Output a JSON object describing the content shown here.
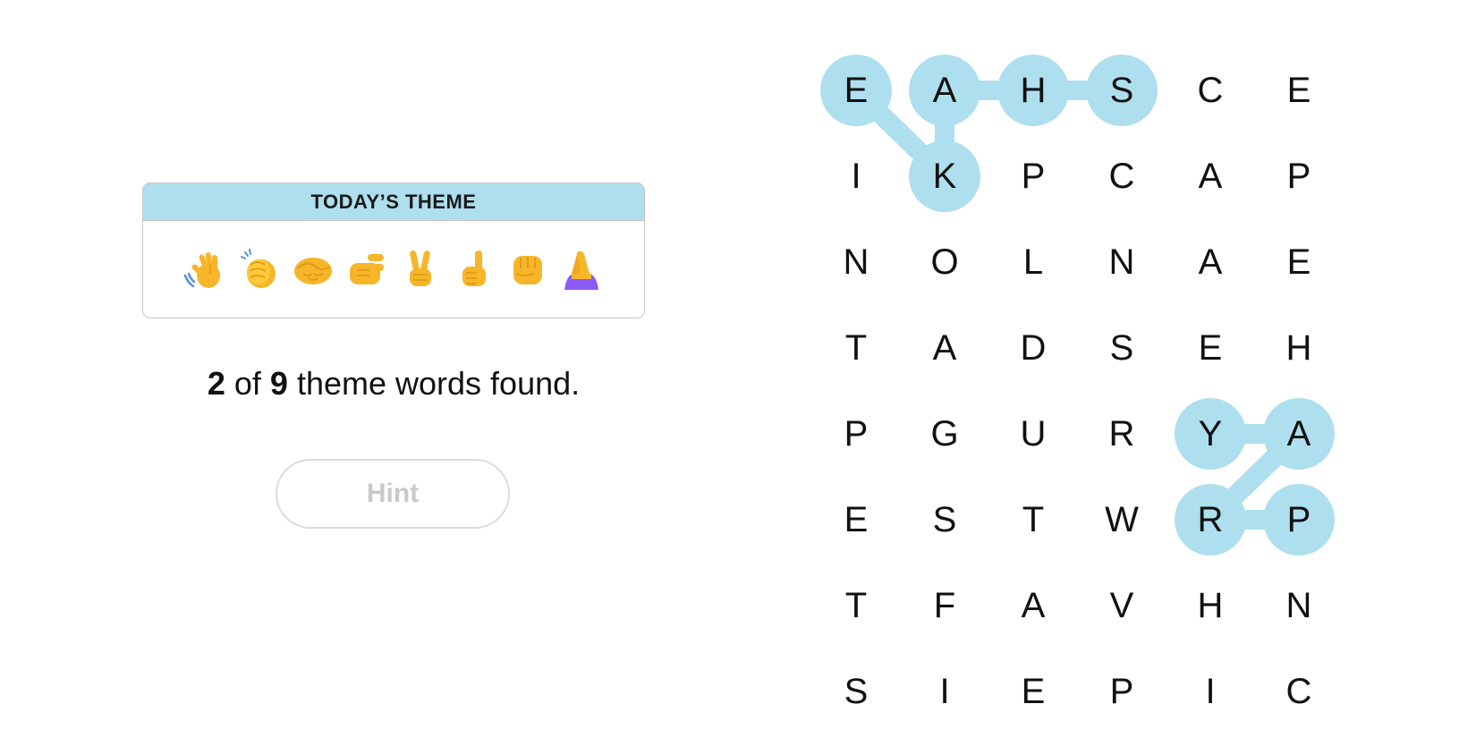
{
  "theme": {
    "header": "TODAY’S THEME",
    "emojis": [
      "waving-hand",
      "clapping-hands",
      "handshake",
      "pinching-hand",
      "victory-hand",
      "index-pointing-up",
      "raised-fist",
      "folded-hands"
    ]
  },
  "progress": {
    "found": "2",
    "of_word": "of",
    "total": "9",
    "suffix": "theme words found."
  },
  "hint_label": "Hint",
  "colors": {
    "highlight": "#aedfee",
    "theme_header": "#aedfee",
    "text": "#111111"
  },
  "grid": [
    [
      "E",
      "A",
      "H",
      "S",
      "C",
      "E"
    ],
    [
      "I",
      "K",
      "P",
      "C",
      "A",
      "P"
    ],
    [
      "N",
      "O",
      "L",
      "N",
      "A",
      "E"
    ],
    [
      "T",
      "A",
      "D",
      "S",
      "E",
      "H"
    ],
    [
      "P",
      "G",
      "U",
      "R",
      "Y",
      "A"
    ],
    [
      "E",
      "S",
      "T",
      "W",
      "R",
      "P"
    ],
    [
      "T",
      "F",
      "A",
      "V",
      "H",
      "N"
    ],
    [
      "S",
      "I",
      "E",
      "P",
      "I",
      "C"
    ]
  ],
  "found_paths": [
    {
      "word": "SHAKE",
      "cells": [
        [
          0,
          3
        ],
        [
          0,
          2
        ],
        [
          0,
          1
        ],
        [
          1,
          1
        ],
        [
          0,
          0
        ]
      ]
    },
    {
      "word": "PRAY",
      "cells": [
        [
          5,
          5
        ],
        [
          5,
          4
        ],
        [
          4,
          5
        ],
        [
          4,
          4
        ]
      ]
    }
  ]
}
